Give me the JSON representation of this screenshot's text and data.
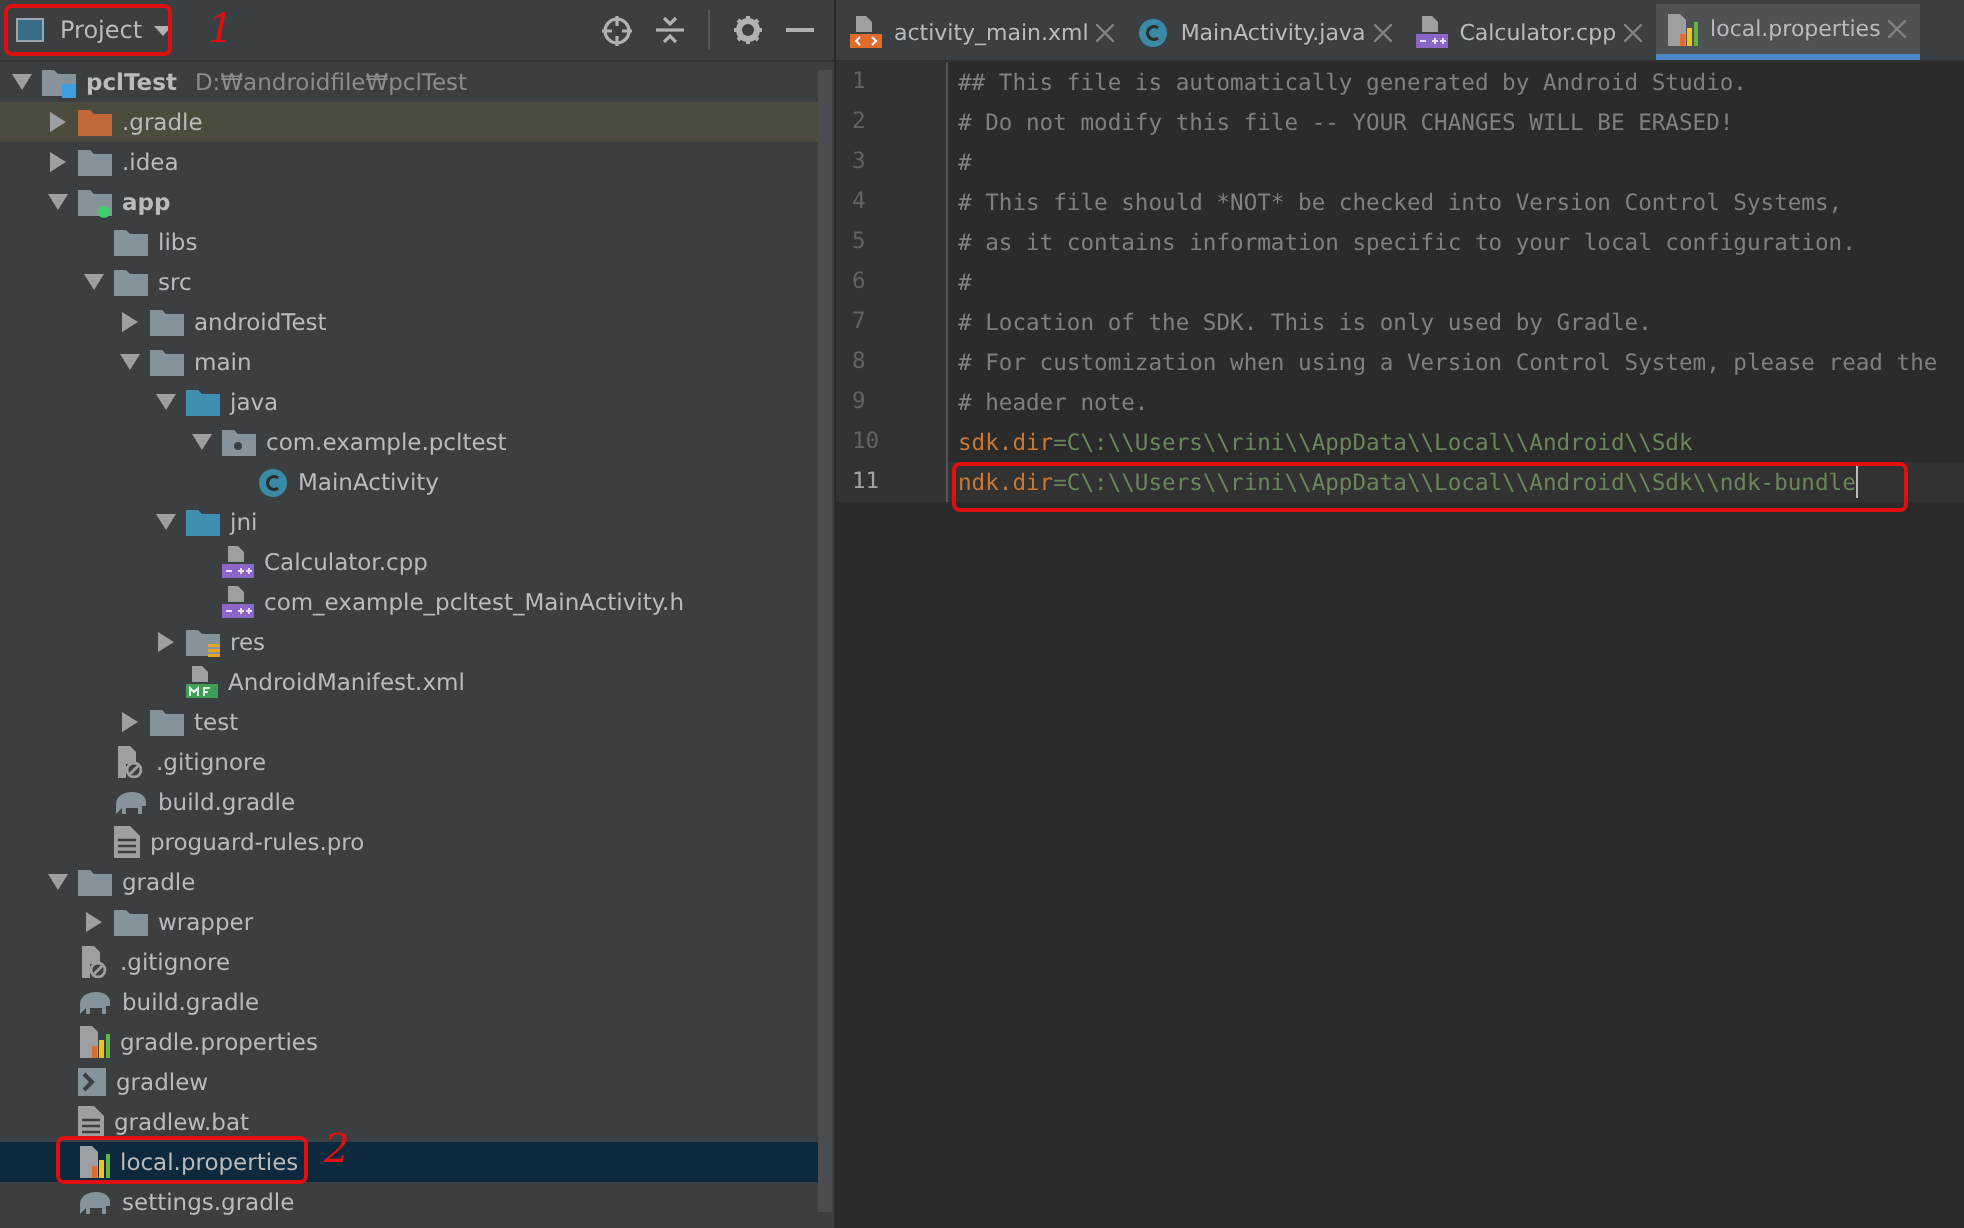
{
  "project_panel": {
    "view_selector": "Project",
    "tree": [
      {
        "label": "pclTest",
        "path": "D:₩androidfile₩pclTest",
        "kind": "project",
        "expanded": true,
        "selected": false,
        "children": [
          {
            "label": ".gradle",
            "kind": "excluded_folder",
            "expanded": false,
            "selected": false
          },
          {
            "label": ".idea",
            "kind": "folder",
            "expanded": false,
            "selected": false
          },
          {
            "label": "app",
            "kind": "module",
            "expanded": true,
            "selected": false,
            "children": [
              {
                "label": "libs",
                "kind": "folder",
                "selected": false
              },
              {
                "label": "src",
                "kind": "folder",
                "expanded": true,
                "selected": false,
                "children": [
                  {
                    "label": "androidTest",
                    "kind": "folder",
                    "expanded": false,
                    "selected": false
                  },
                  {
                    "label": "main",
                    "kind": "folder",
                    "expanded": true,
                    "selected": false,
                    "children": [
                      {
                        "label": "java",
                        "kind": "source_folder",
                        "expanded": true,
                        "selected": false,
                        "children": [
                          {
                            "label": "com.example.pcltest",
                            "kind": "package",
                            "expanded": true,
                            "selected": false,
                            "children": [
                              {
                                "label": "MainActivity",
                                "kind": "class",
                                "selected": false
                              }
                            ]
                          }
                        ]
                      },
                      {
                        "label": "jni",
                        "kind": "source_folder",
                        "expanded": true,
                        "selected": false,
                        "children": [
                          {
                            "label": "Calculator.cpp",
                            "kind": "cpp",
                            "selected": false
                          },
                          {
                            "label": "com_example_pcltest_MainActivity.h",
                            "kind": "cpp",
                            "selected": false
                          }
                        ]
                      },
                      {
                        "label": "res",
                        "kind": "res_folder",
                        "expanded": false,
                        "selected": false
                      },
                      {
                        "label": "AndroidManifest.xml",
                        "kind": "manifest",
                        "selected": false
                      }
                    ]
                  },
                  {
                    "label": "test",
                    "kind": "folder",
                    "expanded": false,
                    "selected": false
                  }
                ]
              },
              {
                "label": ".gitignore",
                "kind": "ignore",
                "selected": false
              },
              {
                "label": "build.gradle",
                "kind": "gradle",
                "selected": false
              },
              {
                "label": "proguard-rules.pro",
                "kind": "text",
                "selected": false
              }
            ]
          },
          {
            "label": "gradle",
            "kind": "folder",
            "expanded": true,
            "selected": false,
            "children": [
              {
                "label": "wrapper",
                "kind": "folder",
                "expanded": false,
                "selected": false
              }
            ]
          },
          {
            "label": ".gitignore",
            "kind": "ignore",
            "selected": false
          },
          {
            "label": "build.gradle",
            "kind": "gradle",
            "selected": false
          },
          {
            "label": "gradle.properties",
            "kind": "properties",
            "selected": false
          },
          {
            "label": "gradlew",
            "kind": "shell",
            "selected": false
          },
          {
            "label": "gradlew.bat",
            "kind": "text",
            "selected": false
          },
          {
            "label": "local.properties",
            "kind": "properties",
            "selected": true
          },
          {
            "label": "settings.gradle",
            "kind": "gradle",
            "selected": false
          }
        ]
      }
    ]
  },
  "editor": {
    "tabs": [
      {
        "label": "activity_main.xml",
        "kind": "xml",
        "selected": false
      },
      {
        "label": "MainActivity.java",
        "kind": "class",
        "selected": false
      },
      {
        "label": "Calculator.cpp",
        "kind": "cpp",
        "selected": false
      },
      {
        "label": "local.properties",
        "kind": "properties",
        "selected": true
      }
    ],
    "lines": [
      {
        "number": "1",
        "kind": "comment",
        "text": "## This file is automatically generated by Android Studio.",
        "current": false
      },
      {
        "number": "2",
        "kind": "comment",
        "text": "# Do not modify this file -- YOUR CHANGES WILL BE ERASED!",
        "current": false
      },
      {
        "number": "3",
        "kind": "comment",
        "text": "#",
        "current": false
      },
      {
        "number": "4",
        "kind": "comment",
        "text": "# This file should *NOT* be checked into Version Control Systems,",
        "current": false
      },
      {
        "number": "5",
        "kind": "comment",
        "text": "# as it contains information specific to your local configuration.",
        "current": false
      },
      {
        "number": "6",
        "kind": "comment",
        "text": "#",
        "current": false
      },
      {
        "number": "7",
        "kind": "comment",
        "text": "# Location of the SDK. This is only used by Gradle.",
        "current": false
      },
      {
        "number": "8",
        "kind": "comment",
        "text": "# For customization when using a Version Control System, please read the",
        "current": false
      },
      {
        "number": "9",
        "kind": "comment",
        "text": "# header note.",
        "current": false
      },
      {
        "number": "10",
        "kind": "property",
        "key": "sdk.dir",
        "separator": "=",
        "value": "C\\:\\\\Users\\\\rini\\\\AppData\\\\Local\\\\Android\\\\Sdk",
        "current": false
      },
      {
        "number": "11",
        "kind": "property",
        "key": "ndk.dir",
        "separator": "=",
        "value": "C\\:\\\\Users\\\\rini\\\\AppData\\\\Local\\\\Android\\\\Sdk\\\\ndk-bundle",
        "current": true
      }
    ]
  },
  "annotations": [
    {
      "kind": "box"
    },
    {
      "kind": "mark",
      "text": "1"
    },
    {
      "kind": "box"
    },
    {
      "kind": "box"
    },
    {
      "kind": "mark",
      "text": "2"
    }
  ]
}
